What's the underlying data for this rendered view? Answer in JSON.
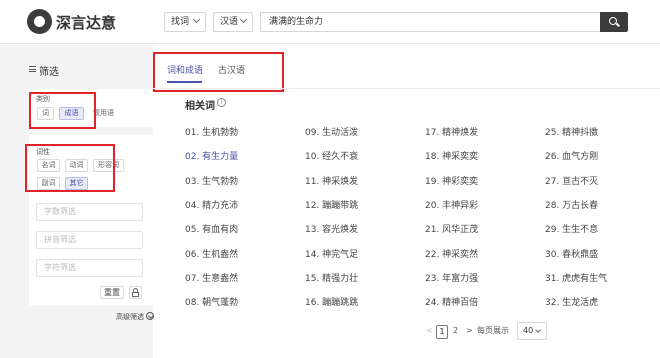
{
  "header": {
    "brand": "深言达意",
    "mode_select": "找词",
    "lang_select": "汉语",
    "search_value": "满满的生命力"
  },
  "sidebar": {
    "title": "筛选",
    "category_label": "类别",
    "category_chips": [
      "词",
      "成语",
      "惯用语"
    ],
    "pos_label": "词性",
    "pos_chips": [
      "名词",
      "动词",
      "形容词",
      "副词",
      "其它"
    ],
    "inputs": [
      "字数筛选",
      "拼音筛选",
      "字符筛选"
    ],
    "reset": "重置",
    "advanced": "高级筛选"
  },
  "tabs": [
    "词和成语",
    "古汉语"
  ],
  "results": {
    "title": "相关词",
    "columns": [
      [
        "01. 生机勃勃",
        "02. 有生力量",
        "03. 生气勃勃",
        "04. 精力充沛",
        "05. 有血有肉",
        "06. 生机盎然",
        "07. 生意盎然",
        "08. 朝气蓬勃"
      ],
      [
        "09. 生动活泼",
        "10. 经久不衰",
        "11. 神采焕发",
        "12. 蹦蹦带跳",
        "13. 容光焕发",
        "14. 神完气足",
        "15. 精强力壮",
        "16. 蹦蹦跳跳"
      ],
      [
        "17. 精神焕发",
        "18. 神采奕奕",
        "19. 神彩奕奕",
        "20. 丰神异彩",
        "21. 风华正茂",
        "22. 神采奕然",
        "23. 年富力强",
        "24. 精神百倍"
      ],
      [
        "25. 精神抖擞",
        "26. 血气方刚",
        "27. 亘古不灭",
        "28. 万古长春",
        "29. 生生不息",
        "30. 春秋鼎盛",
        "31. 虎虎有生气",
        "32. 生龙活虎"
      ]
    ]
  },
  "pagination": {
    "prev": "<",
    "current": "1",
    "page2": "2",
    "next": ">",
    "per_page_label": "每页展示",
    "per_page": "40"
  },
  "colors": {
    "accent": "#4a54a8",
    "annotation": "#e0242a",
    "header_button": "#3c3c3c"
  }
}
